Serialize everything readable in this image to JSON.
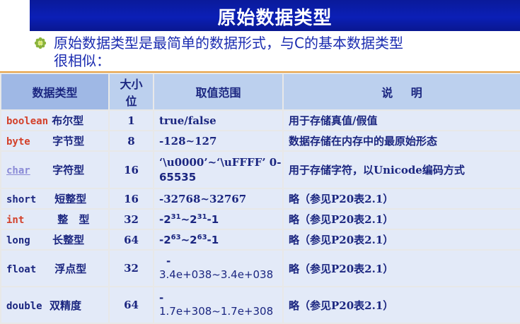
{
  "slide": {
    "title": "原始数据类型",
    "intro_line1": "原始数据类型是最简单的数据形式，与C的基本数据类型",
    "intro_line2": "很相似："
  },
  "table": {
    "headers": [
      "数据类型",
      "大小位",
      "取值范围",
      "说 明"
    ],
    "header_size_line1": "大小",
    "header_size_line2": "位",
    "rows": [
      {
        "kw": "boolean",
        "cn": "布尔型",
        "size": "1",
        "range": "true/false",
        "desc": "用于存储真值/假值"
      },
      {
        "kw": "byte",
        "cn": "字节型",
        "size": "8",
        "range": "-128~127",
        "desc": "数据存储在内存中的最原始形态"
      },
      {
        "kw": "char",
        "cn": "字符型",
        "size": "16",
        "range_a": "‘\\u0000’~‘\\uFFFF’ 0-",
        "range_b": "65535",
        "desc": "用于存储字符，以Unicode编码方式"
      },
      {
        "kw": "short",
        "cn": "短整型",
        "size": "16",
        "range": "-32768~32767",
        "desc": "略（参见P20表2.1）"
      },
      {
        "kw": "int",
        "cn": "整 型",
        "size": "32",
        "range_base1": "-2",
        "range_exp1": "31",
        "range_mid": "~2",
        "range_exp2": "31",
        "range_end": "-1",
        "desc": "略（参见P20表2.1）"
      },
      {
        "kw": "long",
        "cn": "长整型",
        "size": "64",
        "range_base1": "-2",
        "range_exp1": "63",
        "range_mid": "~2",
        "range_exp2": "63",
        "range_end": "-1",
        "desc": "略（参见P20表2.1）"
      },
      {
        "kw": "float",
        "cn": "浮点型",
        "size": "32",
        "range_a": "-",
        "range_b": "3.4e+038~3.4e+038",
        "desc": "略（参见P20表2.1）"
      },
      {
        "kw": "double",
        "cn": "双精度",
        "size": "64",
        "range_a": "-",
        "range_b": "1.7e+308~1.7e+308",
        "desc": "略（参见P20表2.1）"
      }
    ]
  },
  "colors": {
    "title_bar": "#0b1fb6",
    "keyword_red": "#d3402a",
    "text_navy": "#1b2680",
    "cell_bg": "#e3eaf8",
    "header_bg": "#bcd0ee"
  }
}
